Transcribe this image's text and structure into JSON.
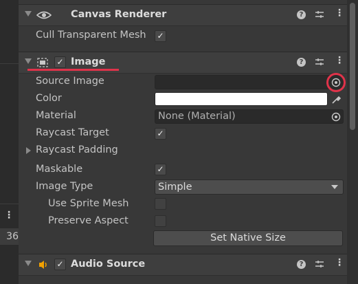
{
  "left_panel": {
    "count_text": "36"
  },
  "components": {
    "canvas_renderer": {
      "title": "Canvas Renderer",
      "cull_label": "Cull Transparent Mesh",
      "cull_checked": true
    },
    "image": {
      "title": "Image",
      "enabled": true,
      "source_image_label": "Source Image",
      "source_image_value": "",
      "color_label": "Color",
      "color_value": "#FFFFFF",
      "material_label": "Material",
      "material_value": "None (Material)",
      "raycast_target_label": "Raycast Target",
      "raycast_target_checked": true,
      "raycast_padding_label": "Raycast Padding",
      "maskable_label": "Maskable",
      "maskable_checked": true,
      "image_type_label": "Image Type",
      "image_type_value": "Simple",
      "use_sprite_mesh_label": "Use Sprite Mesh",
      "use_sprite_mesh_checked": false,
      "preserve_aspect_label": "Preserve Aspect",
      "preserve_aspect_checked": false,
      "set_native_size_label": "Set Native Size"
    },
    "audio_source": {
      "title": "Audio Source",
      "enabled": true
    }
  },
  "icons": {
    "help": "?",
    "checkmark": "✓",
    "kebab": "⋮"
  },
  "colors": {
    "highlight": "#e0334a",
    "audio_icon": "#f0a000"
  }
}
